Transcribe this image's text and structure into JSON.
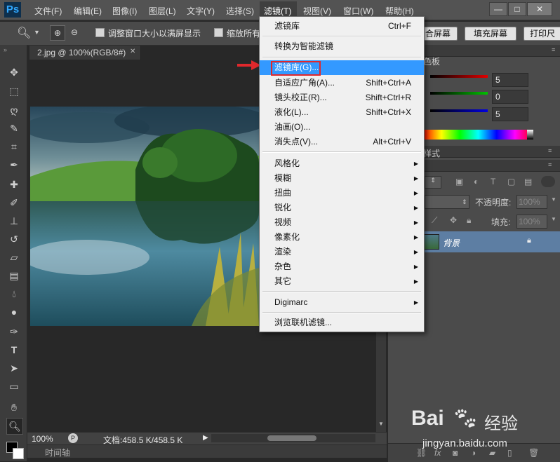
{
  "app": {
    "logo": "Ps"
  },
  "menubar": {
    "items": [
      "文件(F)",
      "编辑(E)",
      "图像(I)",
      "图层(L)",
      "文字(Y)",
      "选择(S)",
      "滤镜(T)",
      "视图(V)",
      "窗口(W)",
      "帮助(H)"
    ],
    "active": "滤镜(T)"
  },
  "window_controls": {
    "minimize": "—",
    "restore": "□",
    "close": "✕"
  },
  "options_bar": {
    "resize_label": "调整窗口大小以满屏显示",
    "zoom_all_label": "缩放所有",
    "fit_screen": "合屏幕",
    "fill_screen": "填充屏幕",
    "print_size": "打印尺"
  },
  "document": {
    "tab_title": "2.jpg @ 100%(RGB/8#)",
    "tab_close": "✕"
  },
  "status": {
    "zoom": "100%",
    "doc_size": "文档:458.5 K/458.5 K"
  },
  "timeline": {
    "label": "时间轴"
  },
  "color_panel": {
    "title": "色板",
    "r": "5",
    "g": "0",
    "b": "5",
    "colors": {
      "r": "#e00000",
      "g": "#00c000",
      "b": "#0000e0"
    }
  },
  "styles_panel": {
    "title": "样式"
  },
  "layers_panel": {
    "opacity_label": "不透明度:",
    "opacity_value": "100%",
    "fill_label": "填充:",
    "fill_value": "100%",
    "layer_name": "背景"
  },
  "filter_menu": {
    "groups": [
      [
        {
          "label": "滤镜库",
          "shortcut": "Ctrl+F"
        }
      ],
      [
        {
          "label": "转换为智能滤镜",
          "shortcut": ""
        }
      ],
      [
        {
          "label": "滤镜库(G)...",
          "shortcut": "",
          "highlight": true
        },
        {
          "label": "自适应广角(A)...",
          "shortcut": "Shift+Ctrl+A"
        },
        {
          "label": "镜头校正(R)...",
          "shortcut": "Shift+Ctrl+R"
        },
        {
          "label": "液化(L)...",
          "shortcut": "Shift+Ctrl+X"
        },
        {
          "label": "油画(O)...",
          "shortcut": ""
        },
        {
          "label": "消失点(V)...",
          "shortcut": "Alt+Ctrl+V"
        }
      ],
      [
        {
          "label": "风格化",
          "submenu": true
        },
        {
          "label": "模糊",
          "submenu": true
        },
        {
          "label": "扭曲",
          "submenu": true
        },
        {
          "label": "锐化",
          "submenu": true
        },
        {
          "label": "视频",
          "submenu": true
        },
        {
          "label": "像素化",
          "submenu": true
        },
        {
          "label": "渲染",
          "submenu": true
        },
        {
          "label": "杂色",
          "submenu": true
        },
        {
          "label": "其它",
          "submenu": true
        }
      ],
      [
        {
          "label": "Digimarc",
          "submenu": true
        }
      ],
      [
        {
          "label": "浏览联机滤镜...",
          "shortcut": ""
        }
      ]
    ]
  },
  "watermark": {
    "brand": "Bai",
    "brand2": "经验",
    "url": "jingyan.baidu.com"
  }
}
